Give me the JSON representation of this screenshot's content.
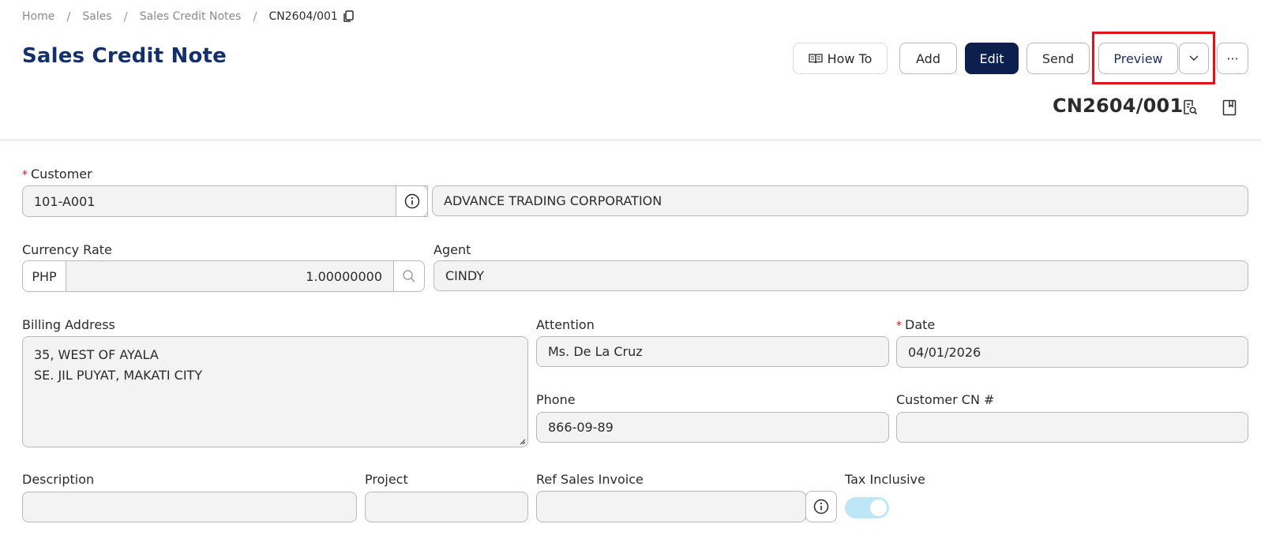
{
  "breadcrumb": {
    "items": [
      "Home",
      "Sales",
      "Sales Credit Notes"
    ],
    "current": "CN2604/001",
    "separator": "/"
  },
  "page_title": "Sales Credit Note",
  "toolbar": {
    "howto_label": "How To",
    "add_label": "Add",
    "edit_label": "Edit",
    "send_label": "Send",
    "preview_label": "Preview",
    "more_label": "···"
  },
  "document": {
    "number": "CN2604/001"
  },
  "form": {
    "customer": {
      "label": "Customer",
      "code": "101-A001",
      "name": "ADVANCE TRADING CORPORATION"
    },
    "currency_rate": {
      "label": "Currency Rate",
      "currency": "PHP",
      "rate": "1.00000000"
    },
    "agent": {
      "label": "Agent",
      "value": "CINDY"
    },
    "billing_address": {
      "label": "Billing Address",
      "line1": "35, WEST OF AYALA",
      "line2": "SE. JIL PUYAT, MAKATI CITY"
    },
    "attention": {
      "label": "Attention",
      "value": "Ms. De La Cruz"
    },
    "date": {
      "label": "Date",
      "value": "04/01/2026"
    },
    "phone": {
      "label": "Phone",
      "value": "866-09-89"
    },
    "customer_cn": {
      "label": "Customer CN #",
      "value": ""
    },
    "description": {
      "label": "Description",
      "value": ""
    },
    "project": {
      "label": "Project",
      "value": ""
    },
    "ref_sales_invoice": {
      "label": "Ref Sales Invoice",
      "value": ""
    },
    "tax_inclusive": {
      "label": "Tax Inclusive",
      "value": "on"
    }
  },
  "colors": {
    "title": "#14306a",
    "primary_button": "#0d1f4d",
    "highlight": "#e0121b",
    "required_marker": "#e0121b",
    "toggle_on": "#bfe6f7"
  }
}
